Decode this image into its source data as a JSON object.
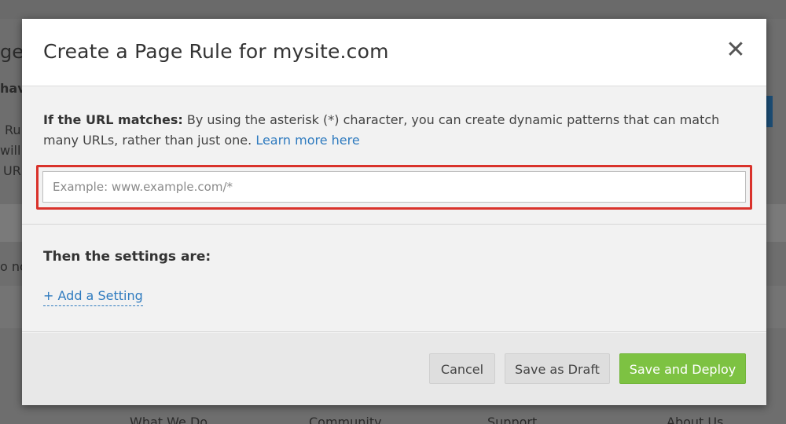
{
  "background": {
    "fragments": [
      "ge",
      "hav",
      "Ru",
      "will",
      "UR",
      "o no"
    ],
    "footer_links": [
      "What We Do",
      "Community",
      "Support",
      "About Us"
    ]
  },
  "modal": {
    "title": "Create a Page Rule for mysite.com",
    "close_icon": "close-icon",
    "url_section": {
      "label_bold": "If the URL matches:",
      "description": " By using the asterisk (*) character, you can create dynamic patterns that can match many URLs, rather than just one. ",
      "learn_more": "Learn more here",
      "input_placeholder": "Example: www.example.com/*",
      "input_value": "",
      "highlight_color": "#d9322b"
    },
    "settings_section": {
      "heading": "Then the settings are:",
      "add_setting": "+ Add a Setting"
    },
    "buttons": {
      "cancel": "Cancel",
      "save_draft": "Save as Draft",
      "save_deploy": "Save and Deploy"
    },
    "colors": {
      "link": "#2f7bbf",
      "primary_button": "#7dc242"
    }
  }
}
